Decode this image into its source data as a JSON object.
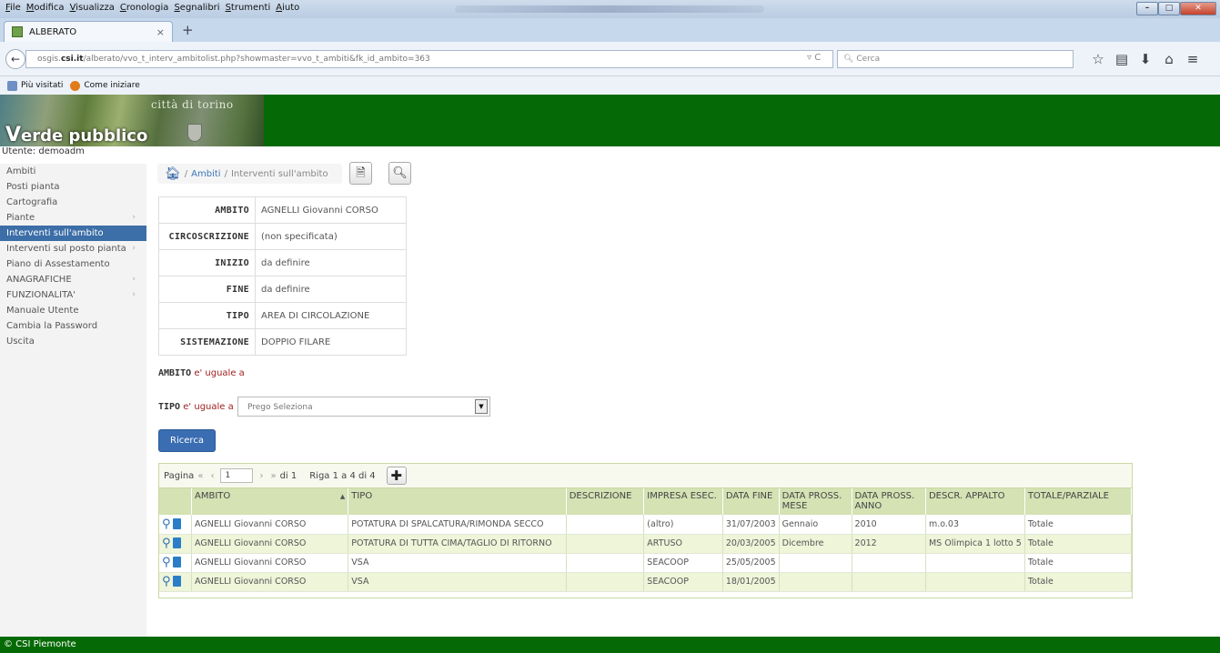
{
  "browser": {
    "menu": [
      "File",
      "Modifica",
      "Visualizza",
      "Cronologia",
      "Segnalibri",
      "Strumenti",
      "Aiuto"
    ],
    "tab_title": "ALBERATO",
    "url_prefix": "osgis.",
    "url_domain": "csi.it",
    "url_rest": "/alberato/vvo_t_interv_ambitolist.php?showmaster=vvo_t_ambiti&fk_id_ambito=363",
    "search_placeholder": "Cerca",
    "bookmarks": [
      "Più visitati",
      "Come iniziare"
    ]
  },
  "header": {
    "city_text": "città di torino",
    "brand_v": "V",
    "brand_rest": "erde pubblico"
  },
  "user_line": "Utente: demoadm",
  "sidebar": {
    "items": [
      {
        "label": "Ambiti",
        "arrow": ""
      },
      {
        "label": "Posti pianta",
        "arrow": ""
      },
      {
        "label": "Cartografia",
        "arrow": ""
      },
      {
        "label": "Piante",
        "arrow": "›"
      },
      {
        "label": "Interventi sull'ambito",
        "arrow": ""
      },
      {
        "label": "Interventi sul posto pianta",
        "arrow": "›"
      },
      {
        "label": "Piano di Assestamento",
        "arrow": ""
      },
      {
        "label": "ANAGRAFICHE",
        "arrow": "›"
      },
      {
        "label": "FUNZIONALITA'",
        "arrow": "›"
      },
      {
        "label": "Manuale Utente",
        "arrow": ""
      },
      {
        "label": "Cambia la Password",
        "arrow": ""
      },
      {
        "label": "Uscita",
        "arrow": ""
      }
    ],
    "active_index": 4
  },
  "breadcrumb": {
    "sep": "/",
    "ambiti": "Ambiti",
    "current": "Interventi sull'ambito"
  },
  "master": {
    "rows": [
      {
        "key": "AMBITO",
        "value": "AGNELLI Giovanni CORSO"
      },
      {
        "key": "CIRCOSCRIZIONE",
        "value": "(non specificata)"
      },
      {
        "key": "INIZIO",
        "value": "da definire"
      },
      {
        "key": "FINE",
        "value": "da definire"
      },
      {
        "key": "TIPO",
        "value": "AREA DI CIRCOLAZIONE"
      },
      {
        "key": "SISTEMAZIONE",
        "value": "DOPPIO FILARE"
      }
    ]
  },
  "filters": {
    "ambito_label": "AMBITO",
    "ambito_op": "e' uguale a",
    "tipo_label": "TIPO",
    "tipo_op": "e' uguale a",
    "tipo_value": "Prego Seleziona",
    "search_button": "Ricerca"
  },
  "pager": {
    "label": "Pagina",
    "page": "1",
    "of": "di 1",
    "rows_info": "Riga 1 a 4 di 4"
  },
  "grid": {
    "columns": [
      "AMBITO",
      "TIPO",
      "DESCRIZIONE",
      "IMPRESA ESEC.",
      "DATA FINE",
      "DATA PROSS. MESE",
      "DATA PROSS. ANNO",
      "DESCR. APPALTO",
      "TOTALE/PARZIALE"
    ],
    "sort_indicator": "▲",
    "rows": [
      [
        "AGNELLI Giovanni CORSO",
        "POTATURA DI SPALCATURA/RIMONDA SECCO",
        "",
        "(altro)",
        "31/07/2003",
        "Gennaio",
        "2010",
        "m.o.03",
        "Totale"
      ],
      [
        "AGNELLI Giovanni CORSO",
        "POTATURA DI TUTTA CIMA/TAGLIO DI RITORNO",
        "",
        "ARTUSO",
        "20/03/2005",
        "Dicembre",
        "2012",
        "MS Olimpica 1 lotto 5",
        "Totale"
      ],
      [
        "AGNELLI Giovanni CORSO",
        "VSA",
        "",
        "SEACOOP",
        "25/05/2005",
        "",
        "",
        "",
        "Totale"
      ],
      [
        "AGNELLI Giovanni CORSO",
        "VSA",
        "",
        "SEACOOP",
        "18/01/2005",
        "",
        "",
        "",
        "Totale"
      ]
    ]
  },
  "footer": "© CSI Piemonte",
  "colors": {
    "brand_green": "#056a05",
    "active_blue": "#3c6ea7",
    "grid_header": "#d4e2b4"
  }
}
